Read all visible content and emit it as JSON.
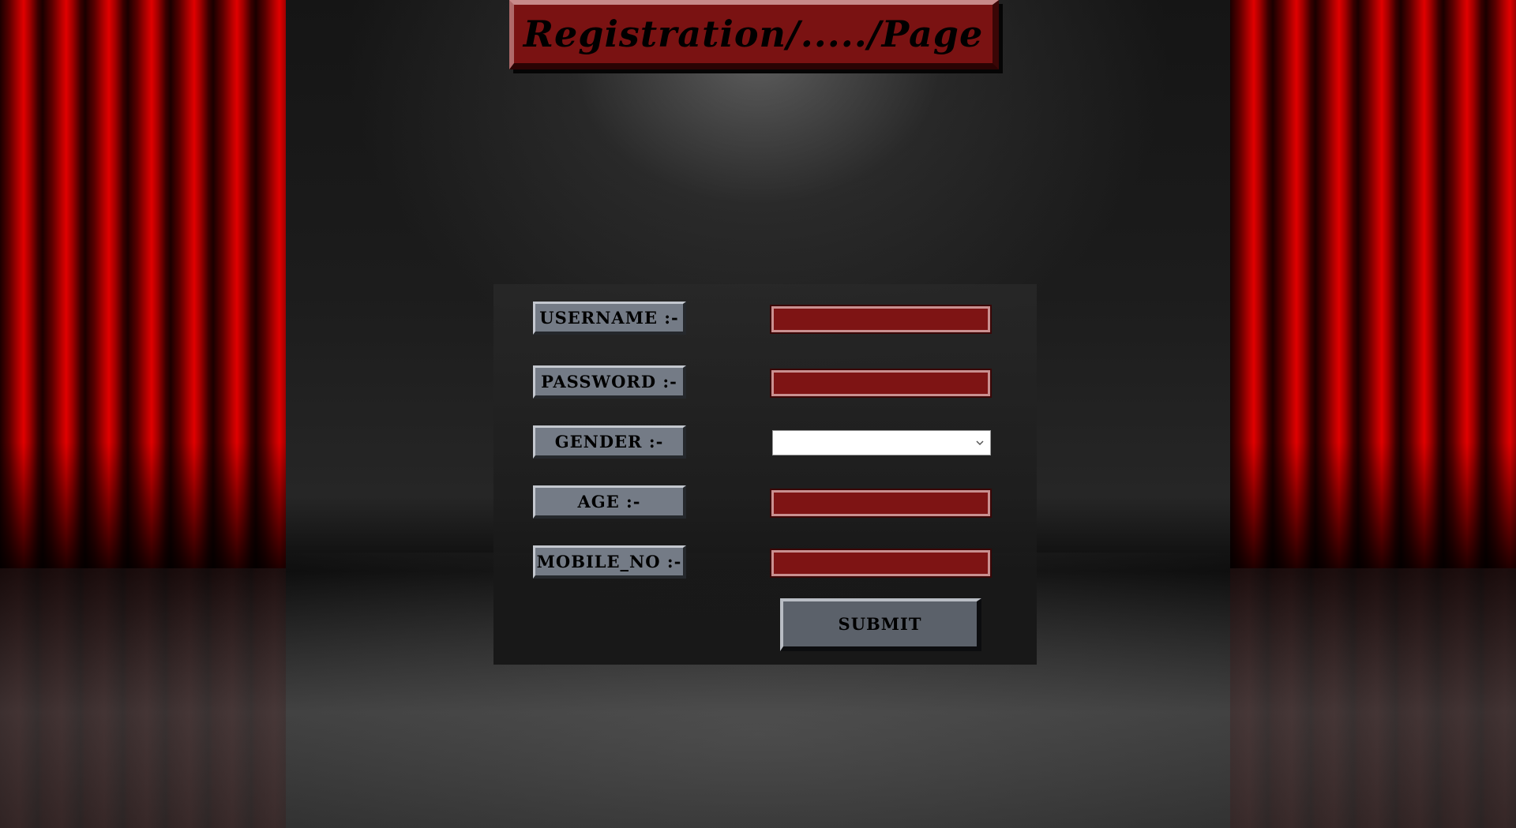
{
  "page": {
    "title": "Registration/...../Page"
  },
  "form": {
    "fields": [
      {
        "label": "USERNAME :-",
        "value": "",
        "type": "text"
      },
      {
        "label": "PASSWORD :-",
        "value": "",
        "type": "password"
      },
      {
        "label": "GENDER :-",
        "selected": "",
        "type": "select"
      },
      {
        "label": "AGE :-",
        "value": "",
        "type": "text"
      },
      {
        "label": "MOBILE_NO :-",
        "value": "",
        "type": "text"
      }
    ],
    "submit_label": "SUBMIT"
  },
  "icons": {
    "gender_dropdown": "chevron-down-icon"
  },
  "colors": {
    "curtain_red": "#c00000",
    "title_background": "#7a1212",
    "field_background": "#7e1414",
    "label_button": "#747b86",
    "submit_button": "#5b616a"
  }
}
